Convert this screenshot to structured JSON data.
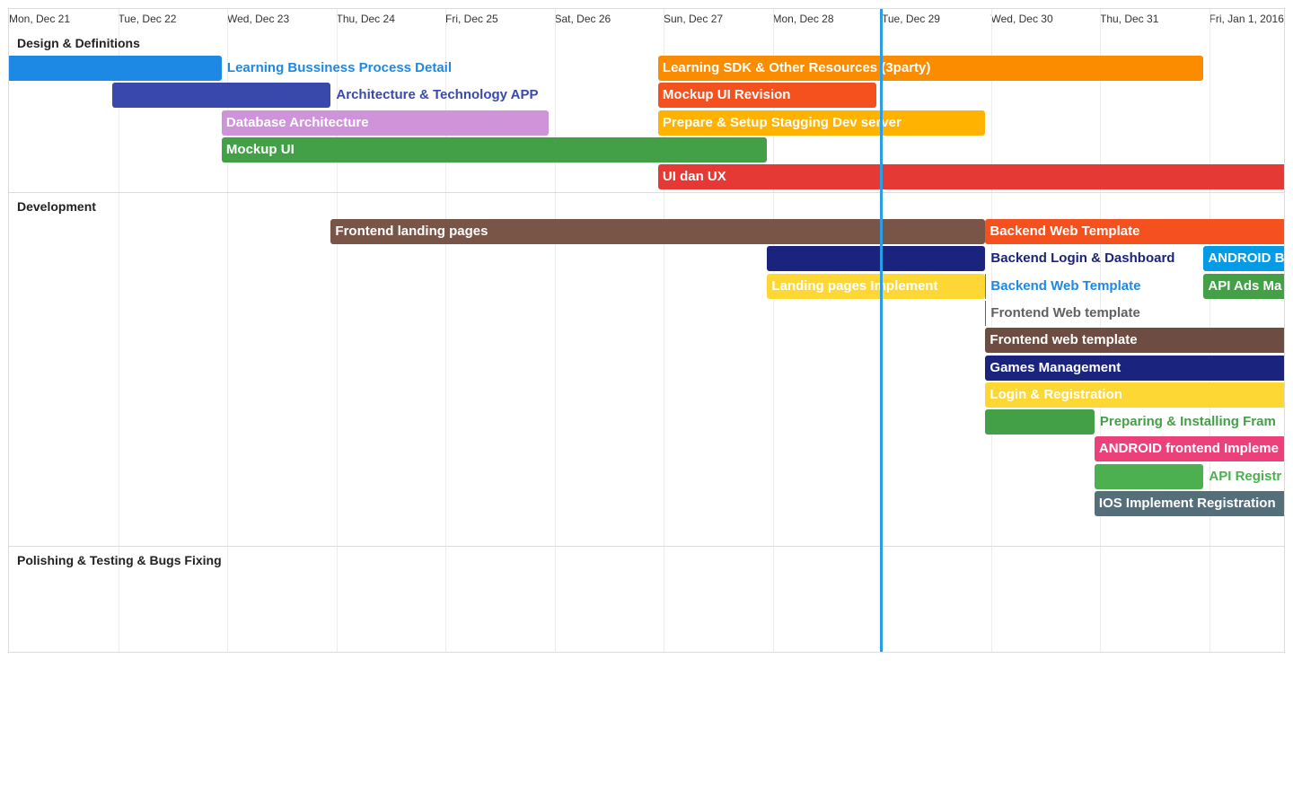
{
  "days": [
    "Mon, Dec 21",
    "Tue, Dec 22",
    "Wed, Dec 23",
    "Thu, Dec 24",
    "Fri, Dec 25",
    "Sat, Dec 26",
    "Sun, Dec 27",
    "Mon, Dec 28",
    "Tue, Dec 29",
    "Wed, Dec 30",
    "Thu, Dec 31",
    "Fri, Jan 1, 2016"
  ],
  "current_time": {
    "date": "Tue, Dec 29"
  },
  "groups": [
    {
      "name": "Design & Definitions",
      "tasks": [
        {
          "label": "Learning Bussiness Process Detail",
          "start": -0.05,
          "end": 1.95,
          "color": "#1e88e5",
          "label_outside": true
        },
        {
          "label": "Architecture & Technology APP",
          "start": 0.95,
          "end": 2.95,
          "color": "#3949ab",
          "label_outside": true
        },
        {
          "label": "Database Architecture",
          "start": 1.95,
          "end": 4.95,
          "color": "#ce93d8",
          "label_outside": false
        },
        {
          "label": "Mockup UI",
          "start": 1.95,
          "end": 6.95,
          "color": "#43a047",
          "label_outside": false
        },
        {
          "label": "Learning SDK & Other Resources (3party)",
          "start": 5.95,
          "end": 10.95,
          "color": "#fb8c00",
          "label_outside": false
        },
        {
          "label": "Mockup UI Revision",
          "start": 5.95,
          "end": 7.95,
          "color": "#f4511e",
          "label_outside": false
        },
        {
          "label": "Prepare & Setup Stagging Dev server",
          "start": 5.95,
          "end": 8.95,
          "color": "#ffb300",
          "label_outside": false
        },
        {
          "label": "UI dan UX",
          "start": 5.95,
          "end": 12.5,
          "color": "#e53935",
          "label_outside": false
        }
      ]
    },
    {
      "name": "Development",
      "tasks": [
        {
          "label": "Frontend landing pages",
          "start": 2.95,
          "end": 8.95,
          "color": "#795548",
          "label_outside": false
        },
        {
          "label": "Backend Web Template",
          "start": 8.95,
          "end": 12.5,
          "color": "#f4511e",
          "label_outside": false
        },
        {
          "label": "Backend Login & Dashboard",
          "start": 6.95,
          "end": 8.95,
          "color": "#1a237e",
          "label_outside": true
        },
        {
          "label": "ANDROID B",
          "start": 10.95,
          "end": 12.5,
          "color": "#039be5",
          "label_outside": false
        },
        {
          "label": "Landing pages Implement",
          "start": 6.95,
          "end": 8.95,
          "color": "#fdd835",
          "label_outside": false
        },
        {
          "label": "Backend Web Template",
          "start": 8.95,
          "end": 8.95,
          "color": "#1e88e5",
          "label_outside": true
        },
        {
          "label": "API Ads Ma",
          "start": 10.95,
          "end": 12.5,
          "color": "#43a047",
          "label_outside": false
        },
        {
          "label": "Frontend Web template",
          "start": 8.95,
          "end": 8.95,
          "color": "#616161",
          "label_outside": true
        },
        {
          "label": "Frontend web template",
          "start": 8.95,
          "end": 12.5,
          "color": "#6d4c41",
          "label_outside": false
        },
        {
          "label": "Games Management",
          "start": 8.95,
          "end": 12.5,
          "color": "#1a237e",
          "label_outside": false
        },
        {
          "label": "Login & Registration",
          "start": 8.95,
          "end": 12.5,
          "color": "#fdd835",
          "label_outside": false
        },
        {
          "label": "Preparing & Installing Fram",
          "start": 8.95,
          "end": 9.95,
          "color": "#43a047",
          "label_outside": true
        },
        {
          "label": "ANDROID frontend Impleme",
          "start": 9.95,
          "end": 12.5,
          "color": "#ec407a",
          "label_outside": false
        },
        {
          "label": "API Registr",
          "start": 9.95,
          "end": 10.95,
          "color": "#4caf50",
          "label_outside": true
        },
        {
          "label": "IOS Implement Registration",
          "start": 9.95,
          "end": 12.5,
          "color": "#546e7a",
          "label_outside": false
        }
      ]
    },
    {
      "name": "Polishing & Testing & Bugs Fixing",
      "tasks": []
    }
  ]
}
